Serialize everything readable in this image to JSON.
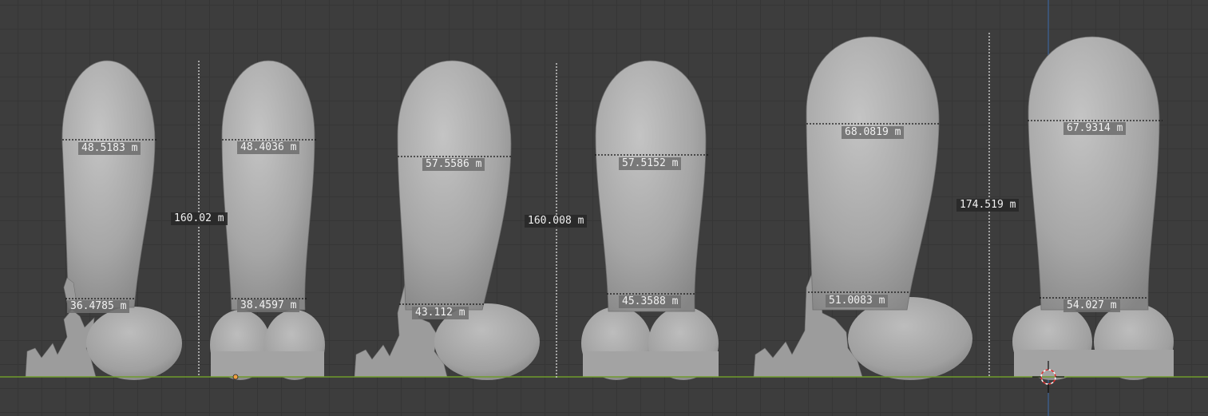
{
  "viewport": {
    "background": "#3d3d3d",
    "grid_color": "#363636",
    "ground_line_color": "#6f9b2c",
    "y_axis_line_color": "#3f6db0",
    "model_color": "#a9a9a9"
  },
  "measurements": {
    "m1_tip": "48.5183 m",
    "m1_base": "36.4785 m",
    "m2_tip": "48.4036 m",
    "m2_base": "38.4597 m",
    "h12": "160.02 m",
    "m3_tip": "57.5586 m",
    "m3_base": "43.112 m",
    "m4_tip": "57.5152 m",
    "m4_base": "45.3588 m",
    "h34": "160.008 m",
    "m5_tip": "68.0819 m",
    "m5_base": "51.0083 m",
    "m6_tip": "67.9314 m",
    "m6_base": "54.027 m",
    "h56": "174.519 m"
  },
  "icons": {
    "cursor": "3d-cursor-icon",
    "origin": "object-origin-icon"
  }
}
